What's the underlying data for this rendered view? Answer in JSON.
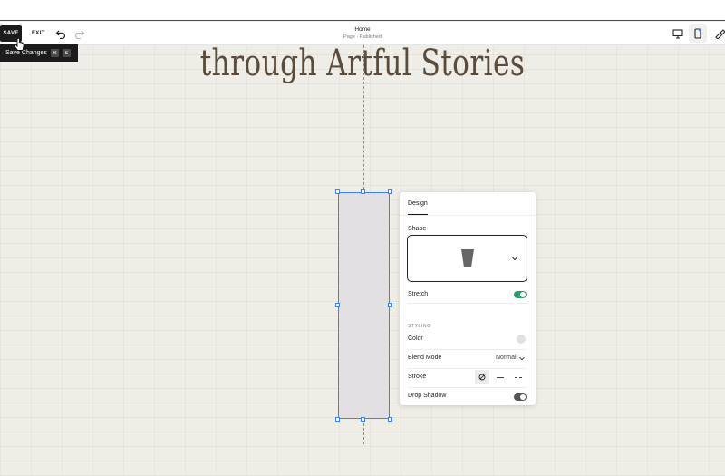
{
  "toolbar": {
    "save_label": "SAVE",
    "exit_label": "EXIT",
    "page_title": "Home",
    "page_status": "Page · Published",
    "undo_icon": "undo-icon",
    "redo_icon": "redo-icon",
    "desktop_icon": "desktop-icon",
    "mobile_icon": "mobile-icon",
    "design_icon": "paintbrush-icon"
  },
  "tooltip": {
    "label": "Save Changes",
    "key1": "⌘",
    "key2": "S"
  },
  "canvas": {
    "headline": "through Artful Stories"
  },
  "design_panel": {
    "tab": "Design",
    "shape_label": "Shape",
    "stretch_label": "Stretch",
    "stretch_on": true,
    "styling_label": "STYLING",
    "color_label": "Color",
    "color_value": "#e2e0e2",
    "blend_label": "Blend Mode",
    "blend_value": "Normal",
    "stroke_label": "Stroke",
    "drop_shadow_label": "Drop Shadow",
    "drop_shadow_on": false
  },
  "colors": {
    "selection": "#3b82f6",
    "toggle_on": "#2f9c6c",
    "headline": "#5a4b3b"
  }
}
